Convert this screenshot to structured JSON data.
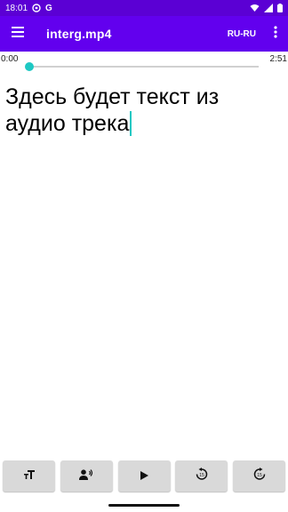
{
  "status_bar": {
    "time": "18:01",
    "icons": [
      "settings-icon",
      "google-icon",
      "wifi-icon",
      "signal-icon",
      "battery-icon"
    ]
  },
  "app_bar": {
    "title": "interg.mp4",
    "language": "RU-RU",
    "icons": [
      "menu-icon",
      "more-vert-icon"
    ]
  },
  "player": {
    "current_time": "0:00",
    "total_time": "2:51",
    "progress": 0.0
  },
  "transcript": {
    "text": "Здесь будет текст из аудио трека"
  },
  "controls": {
    "buttons": [
      "text-size-icon",
      "voice-icon",
      "play-icon",
      "rewind-15-icon",
      "forward-15-icon"
    ]
  },
  "colors": {
    "status_bar": "#5b00d4",
    "app_bar": "#6200ee",
    "accent": "#1ec8c3",
    "control_button": "#d9d9d9"
  }
}
